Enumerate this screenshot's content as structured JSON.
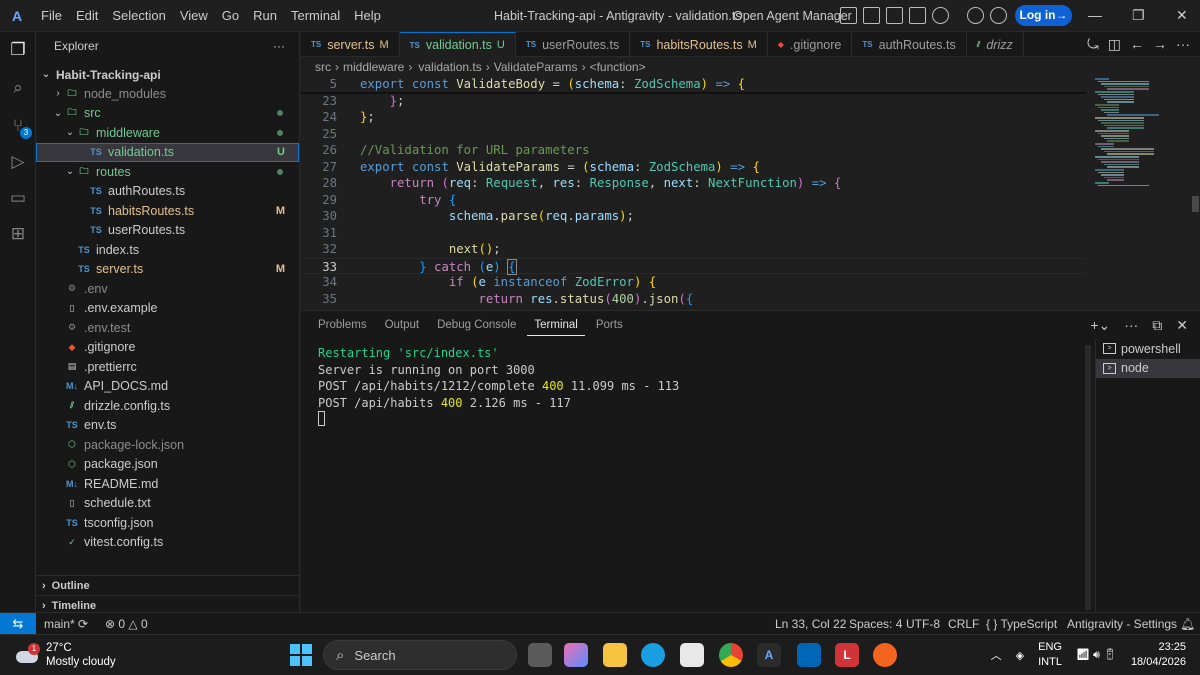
{
  "app": {
    "menu": [
      "File",
      "Edit",
      "Selection",
      "View",
      "Go",
      "Run",
      "Terminal",
      "Help"
    ],
    "window_title": "Habit-Tracking-api - Antigravity - validation.ts",
    "agent_manager": "Open Agent Manager",
    "login": "Log in→",
    "logo_glyph": "A",
    "minimize": "—",
    "restore": "❐",
    "close": "✕"
  },
  "sidebar": {
    "title": "Explorer",
    "more": "···",
    "root": "Habit-Tracking-api",
    "tree": [
      {
        "label": "node_modules",
        "icon": "folder",
        "indent": 1,
        "chev": "›",
        "dim": true
      },
      {
        "label": "src",
        "icon": "folder",
        "indent": 1,
        "chev": "⌄",
        "dot": true
      },
      {
        "label": "middleware",
        "icon": "folder",
        "indent": 2,
        "chev": "⌄",
        "dot": true
      },
      {
        "label": "validation.ts",
        "icon": "TS",
        "indent": 3,
        "status": "U",
        "selected": true
      },
      {
        "label": "routes",
        "icon": "folder",
        "indent": 2,
        "chev": "⌄",
        "dot": true
      },
      {
        "label": "authRoutes.ts",
        "icon": "TS",
        "indent": 3
      },
      {
        "label": "habitsRoutes.ts",
        "icon": "TS",
        "indent": 3,
        "status": "M"
      },
      {
        "label": "userRoutes.ts",
        "icon": "TS",
        "indent": 3
      },
      {
        "label": "index.ts",
        "icon": "TS",
        "indent": 2
      },
      {
        "label": "server.ts",
        "icon": "TS",
        "indent": 2,
        "status": "M"
      },
      {
        "label": ".env",
        "icon": "gear",
        "indent": 1,
        "dim": true
      },
      {
        "label": ".env.example",
        "icon": "file",
        "indent": 1
      },
      {
        "label": ".env.test",
        "icon": "gear",
        "indent": 1,
        "dim": true
      },
      {
        "label": ".gitignore",
        "icon": "git",
        "indent": 1
      },
      {
        "label": ".prettierrc",
        "icon": "prettier",
        "indent": 1
      },
      {
        "label": "API_DOCS.md",
        "icon": "M↓",
        "indent": 1
      },
      {
        "label": "drizzle.config.ts",
        "icon": "drizzle",
        "indent": 1
      },
      {
        "label": "env.ts",
        "icon": "TS",
        "indent": 1
      },
      {
        "label": "package-lock.json",
        "icon": "npm",
        "indent": 1,
        "dim": true
      },
      {
        "label": "package.json",
        "icon": "npm",
        "indent": 1
      },
      {
        "label": "README.md",
        "icon": "M↓",
        "indent": 1
      },
      {
        "label": "schedule.txt",
        "icon": "file",
        "indent": 1
      },
      {
        "label": "tsconfig.json",
        "icon": "TS",
        "indent": 1
      },
      {
        "label": "vitest.config.ts",
        "icon": "vitest",
        "indent": 1
      }
    ],
    "outline": "Outline",
    "timeline": "Timeline"
  },
  "tabs": [
    {
      "label": "server.ts",
      "mark": "M",
      "active": false
    },
    {
      "label": "validation.ts",
      "mark": "U",
      "active": true
    },
    {
      "label": "userRoutes.ts",
      "mark": "",
      "active": false
    },
    {
      "label": "habitsRoutes.ts",
      "mark": "M",
      "active": false
    },
    {
      "label": ".gitignore",
      "mark": "",
      "active": false,
      "git": true
    },
    {
      "label": "authRoutes.ts",
      "mark": "",
      "active": false
    },
    {
      "label": "drizz",
      "mark": "",
      "active": false,
      "partial": true
    }
  ],
  "breadcrumb": [
    "src",
    "middleware",
    "validation.ts",
    "ValidateParams",
    "<function>"
  ],
  "editor": {
    "lines": [
      {
        "n": "5",
        "html": "<span class=\"kw\">export</span> <span class=\"kw\">const</span> <span class=\"fn\">ValidateBody</span> = <span class=\"br\">(</span><span class=\"var\">schema</span>: <span class=\"ty\">ZodSchema</span><span class=\"br\">)</span> <span class=\"kw\">=&gt;</span> <span class=\"br\">{</span>"
      },
      {
        "n": "23",
        "html": "    <span class=\"br2\">}</span>;"
      },
      {
        "n": "24",
        "html": "<span class=\"br\">}</span>;"
      },
      {
        "n": "25",
        "html": ""
      },
      {
        "n": "26",
        "html": "<span class=\"cm\">//Validation for URL parameters</span>"
      },
      {
        "n": "27",
        "html": "<span class=\"kw\">export</span> <span class=\"kw\">const</span> <span class=\"fn\">ValidateParams</span> = <span class=\"br\">(</span><span class=\"var\">schema</span>: <span class=\"ty\">ZodSchema</span><span class=\"br\">)</span> <span class=\"kw\">=&gt;</span> <span class=\"br\">{</span>"
      },
      {
        "n": "28",
        "html": "    <span class=\"kw2\">return</span> <span class=\"br2\">(</span><span class=\"var\">req</span>: <span class=\"ty\">Request</span>, <span class=\"var\">res</span>: <span class=\"ty\">Response</span>, <span class=\"var\">next</span>: <span class=\"ty\">NextFunction</span><span class=\"br2\">)</span> <span class=\"kw\">=&gt;</span> <span class=\"br2\">{</span>"
      },
      {
        "n": "29",
        "html": "        <span class=\"kw2\">try</span> <span class=\"br3\">{</span>"
      },
      {
        "n": "30",
        "html": "            <span class=\"var\">schema</span>.<span class=\"fn\">parse</span><span class=\"br\">(</span><span class=\"var\">req</span>.<span class=\"var\">params</span><span class=\"br\">)</span>;"
      },
      {
        "n": "31",
        "html": ""
      },
      {
        "n": "32",
        "html": "            <span class=\"fn\">next</span><span class=\"br\">()</span>;"
      },
      {
        "n": "33",
        "html": "        <span class=\"br3\">}</span> <span class=\"kw2\">catch</span> <span class=\"br3\">(</span><span class=\"var\">e</span><span class=\"br3\">)</span> <span class=\"br3\" style=\"outline:1px solid #888\">{</span>",
        "current": true
      },
      {
        "n": "34",
        "html": "            <span class=\"kw2\">if</span> <span class=\"br\">(</span><span class=\"var\">e</span> <span class=\"kw\">instanceof</span> <span class=\"ty\">ZodError</span><span class=\"br\">)</span> <span class=\"br\">{</span>"
      },
      {
        "n": "35",
        "html": "                <span class=\"kw2\">return</span> <span class=\"var\">res</span>.<span class=\"fn\">status</span><span class=\"br2\">(</span><span class=\"num\">400</span><span class=\"br2\">)</span>.<span class=\"fn\">json</span><span class=\"br2\">(</span><span class=\"br3\">{</span>"
      }
    ]
  },
  "panel": {
    "tabs": [
      "Problems",
      "Output",
      "Debug Console",
      "Terminal",
      "Ports"
    ],
    "active_tab": "Terminal",
    "terminal": {
      "line1": "Restarting 'src/index.ts'",
      "line2": "Server is running on port 3000",
      "line3_pre": "POST /api/habits/1212/complete ",
      "line3_code": "400",
      "line3_post": " 11.099 ms - 113",
      "line4_pre": "POST /api/habits ",
      "line4_code": "400",
      "line4_post": " 2.126 ms - 117"
    },
    "terminal_instances": [
      "powershell",
      "node"
    ],
    "selected_instance": "node"
  },
  "statusbar": {
    "branch": "main*",
    "errors": "0",
    "warnings": "0",
    "position": "Ln 33, Col 22",
    "spaces": "Spaces: 4",
    "encoding": "UTF-8",
    "eol": "CRLF",
    "language": "TypeScript",
    "settings": "Antigravity - Settings"
  },
  "taskbar": {
    "temperature": "27°C",
    "weather": "Mostly cloudy",
    "weather_badge": "1",
    "search_placeholder": "Search",
    "lang1": "ENG",
    "lang2": "INTL",
    "time": "23:25",
    "date": "18/04/2026"
  },
  "colors": {
    "accent": "#0078d4",
    "modified": "#e2c08d",
    "untracked": "#73c991",
    "login_button": "#0e62d6"
  }
}
